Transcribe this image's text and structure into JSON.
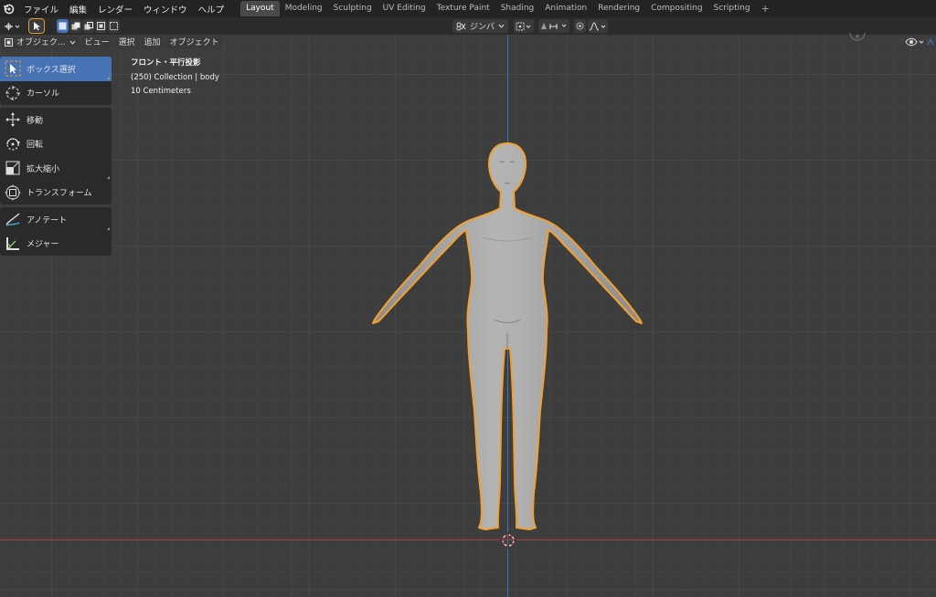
{
  "topbar": {
    "menus": [
      "ファイル",
      "編集",
      "レンダー",
      "ウィンドウ",
      "ヘルプ"
    ],
    "tabs": [
      "Layout",
      "Modeling",
      "Sculpting",
      "UV Editing",
      "Texture Paint",
      "Shading",
      "Animation",
      "Rendering",
      "Compositing",
      "Scripting"
    ],
    "active_tab": "Layout",
    "add_tab": "+"
  },
  "toolheader": {
    "transform_orientation": "ジンバ"
  },
  "vpheader": {
    "mode": "オブジェク...",
    "menus": [
      "ビュー",
      "選択",
      "追加",
      "オブジェクト"
    ]
  },
  "toolbar": {
    "groups": [
      [
        {
          "label": "ボックス選択",
          "icon": "box-select-icon",
          "active": true
        },
        {
          "label": "カーソル",
          "icon": "cursor-icon"
        }
      ],
      [
        {
          "label": "移動",
          "icon": "move-icon"
        },
        {
          "label": "回転",
          "icon": "rotate-icon"
        },
        {
          "label": "拡大縮小",
          "icon": "scale-icon"
        },
        {
          "label": "トランスフォーム",
          "icon": "transform-icon"
        }
      ],
      [
        {
          "label": "アノテート",
          "icon": "annotate-icon"
        },
        {
          "label": "メジャー",
          "icon": "measure-icon"
        }
      ]
    ]
  },
  "viewport_info": {
    "view": "フロント・平行投影",
    "collection": "(250) Collection | body",
    "scale": "10 Centimeters"
  },
  "colors": {
    "active_tool": "#4772b3",
    "selection_outline": "#f0a030",
    "axis_z": "#3e6fb8",
    "axis_x": "#a8414a",
    "mesh": "#a3a3a3"
  }
}
